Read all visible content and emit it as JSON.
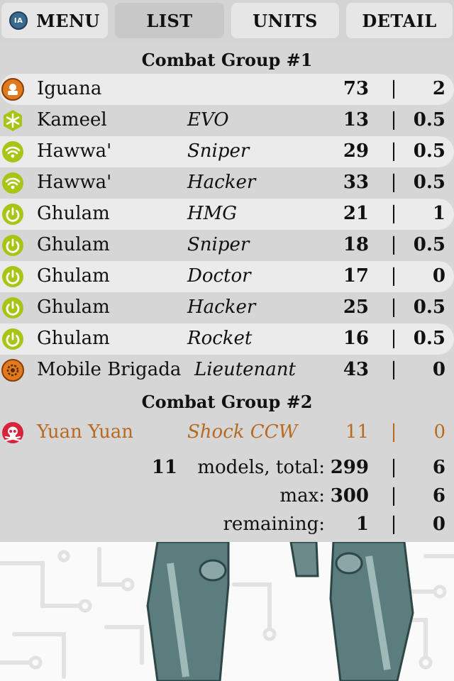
{
  "nav": {
    "menu_label": "MENU",
    "menu_logo_text": "IA",
    "list_label": "LIST",
    "units_label": "UNITS",
    "detail_label": "DETAIL",
    "active_tab": "LIST"
  },
  "groups": [
    {
      "title": "Combat Group #1",
      "rows": [
        {
          "name": "Iguana",
          "profile": "",
          "points": "73",
          "swc": "2",
          "icon": "orange-tag-icon",
          "shade": "light"
        },
        {
          "name": "Kameel",
          "profile": "EVO",
          "points": "13",
          "swc": "0.5",
          "icon": "snowflake-green-icon",
          "shade": "dark"
        },
        {
          "name": "Hawwa'",
          "profile": "Sniper",
          "points": "29",
          "swc": "0.5",
          "icon": "wifi-green-icon",
          "shade": "light"
        },
        {
          "name": "Hawwa'",
          "profile": "Hacker",
          "points": "33",
          "swc": "0.5",
          "icon": "wifi-green-icon",
          "shade": "dark"
        },
        {
          "name": "Ghulam",
          "profile": "HMG",
          "points": "21",
          "swc": "1",
          "icon": "power-green-icon",
          "shade": "light"
        },
        {
          "name": "Ghulam",
          "profile": "Sniper",
          "points": "18",
          "swc": "0.5",
          "icon": "power-green-icon",
          "shade": "dark"
        },
        {
          "name": "Ghulam",
          "profile": "Doctor",
          "points": "17",
          "swc": "0",
          "icon": "power-green-icon",
          "shade": "light"
        },
        {
          "name": "Ghulam",
          "profile": "Hacker",
          "points": "25",
          "swc": "0.5",
          "icon": "power-green-icon",
          "shade": "dark"
        },
        {
          "name": "Ghulam",
          "profile": "Rocket",
          "points": "16",
          "swc": "0.5",
          "icon": "power-green-icon",
          "shade": "light"
        },
        {
          "name": "Mobile Brigada",
          "profile": "Lieutenant",
          "points": "43",
          "swc": "0",
          "icon": "gear-orange-icon",
          "shade": "dark"
        }
      ]
    },
    {
      "title": "Combat Group #2",
      "rows": [
        {
          "name": "Yuan Yuan",
          "profile": "Shock CCW",
          "points": "11",
          "swc": "0",
          "icon": "skull-red-icon",
          "shade": "dark",
          "highlight": true
        }
      ]
    }
  ],
  "separator": "|",
  "totals": {
    "count": "11",
    "total_label": "models, total:",
    "total_points": "299",
    "total_swc": "6",
    "max_label": "max:",
    "max_points": "300",
    "max_swc": "6",
    "remaining_label": "remaining:",
    "remaining_points": "1",
    "remaining_swc": "0"
  },
  "colors": {
    "panel_bg": "#d6d6d6",
    "row_light": "#ebebeb",
    "highlight_text": "#b86a22",
    "icon_green": "#a8c415",
    "icon_orange": "#e07a1c",
    "icon_red": "#d9233a"
  }
}
